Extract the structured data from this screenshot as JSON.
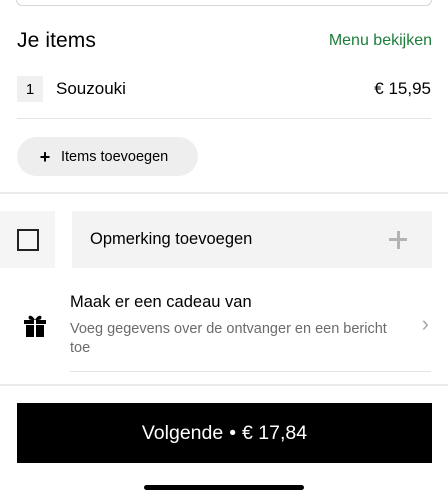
{
  "header": {
    "title": "Je items",
    "menu_link": "Menu bekijken"
  },
  "items": [
    {
      "quantity": "1",
      "name": "Souzouki",
      "price": "€ 15,95"
    }
  ],
  "add_items": {
    "icon": "plus-icon",
    "label": "Items toevoegen"
  },
  "note": {
    "label": "Opmerking toevoegen",
    "checked": false,
    "icon": "plus-icon"
  },
  "gift": {
    "icon": "gift-icon",
    "title": "Maak er een cadeau van",
    "subtitle": "Voeg gegevens over de ontvanger en een bericht toe"
  },
  "cta": {
    "label": "Volgende",
    "separator": "•",
    "total": "€ 17,84"
  },
  "colors": {
    "link_green": "#1c7d3a",
    "cta_bg": "#000000",
    "pill_bg": "#eeeeee"
  }
}
